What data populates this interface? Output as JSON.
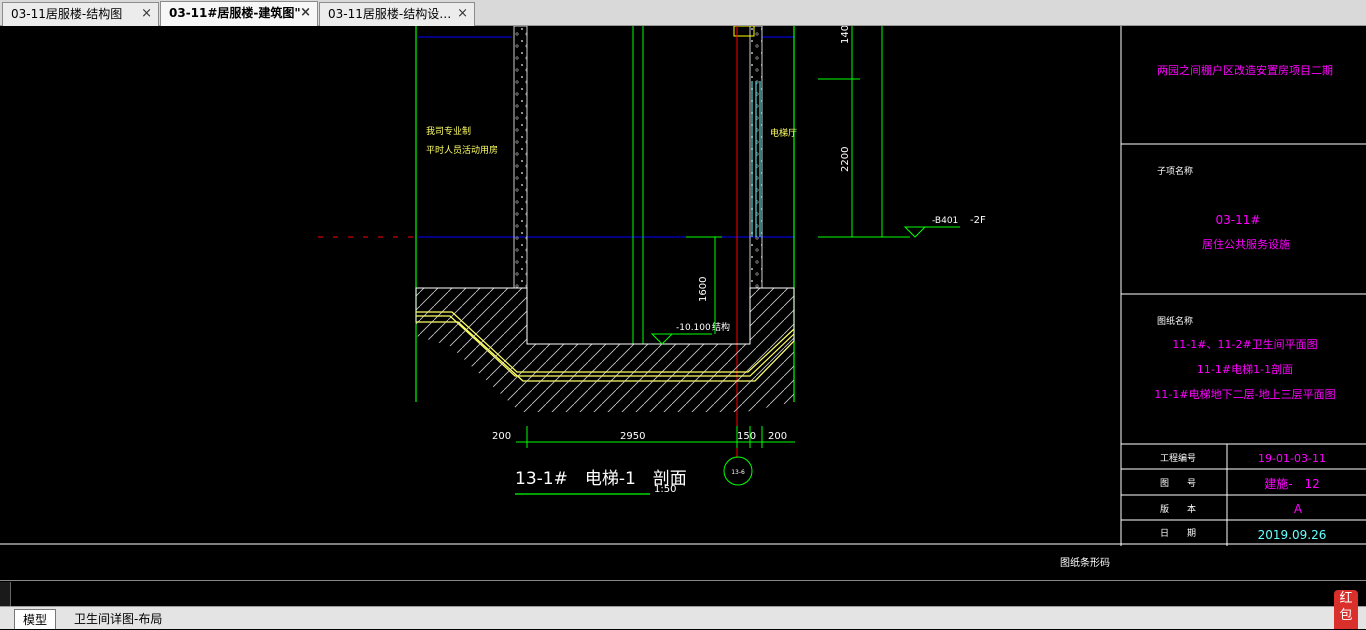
{
  "tabs": [
    {
      "label": "03-11居服楼-结构图",
      "close": "×"
    },
    {
      "label": "03-11#居服楼-建筑图\"",
      "close": "×"
    },
    {
      "label": "03-11居服楼-结构设…",
      "close": "×"
    }
  ],
  "drawing": {
    "dims": {
      "d140": "140",
      "d2200": "2200",
      "d1600": "1600",
      "d200a": "200",
      "d2950": "2950",
      "d150": "150",
      "d200b": "200"
    },
    "labels": {
      "left_note1": "我司专业制",
      "left_note2": "平时人员活动用房",
      "elevator_shaft": "电梯厅",
      "level_b": "-B401",
      "level_b_tag": "-2F",
      "pit_level": "-10.100",
      "pit_struct": "结构",
      "axis_bubble": "13-6"
    },
    "section_title": "13-1#　电梯-1　剖面",
    "section_scale": "1:50"
  },
  "title_block": {
    "project": "两园之间棚户区改造安置房项目二期",
    "subitem_label": "子项名称",
    "subitem_line1": "03-11#",
    "subitem_line2": "居住公共服务设施",
    "drawing_name_label": "图纸名称",
    "drawing_names": [
      "11-1#、11-2#卫生间平面图",
      "11-1#电梯1-1剖面",
      "11-1#电梯地下二层-地上三层平面图"
    ],
    "rows": [
      {
        "label": "工程编号",
        "value": "19-01-03-11"
      },
      {
        "label": "图　　号",
        "value": "建施-　12"
      },
      {
        "label": "版　　本",
        "value": "A"
      },
      {
        "label": "日　　期",
        "value": "2019.09.26"
      }
    ],
    "bottom_label": "图纸条形码"
  },
  "layout_tabs": [
    {
      "label": "模型"
    },
    {
      "label": "卫生间详图-布局"
    }
  ],
  "red_packet": "红包",
  "colors": {
    "magenta": "#ff00ff",
    "yellow": "#ffff66",
    "green": "#00ff00",
    "cyan": "#66ffff",
    "blue": "#0000ff",
    "red": "#ff0000"
  }
}
